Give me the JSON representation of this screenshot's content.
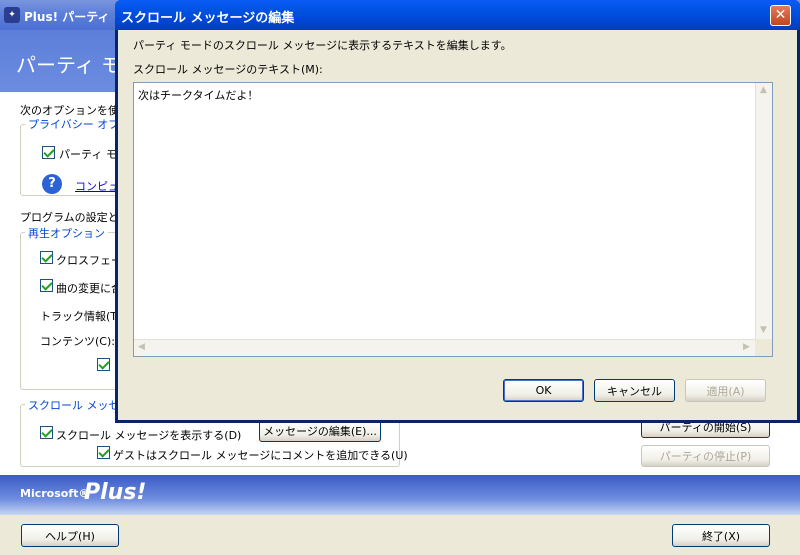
{
  "main_window": {
    "title": "Plus! パーティ モ",
    "banner_title": "パーティ モード",
    "intro_text": "次のオプションを使って",
    "privacy_group": {
      "title": "プライバシー オプショ",
      "checkbox_label": "パーティ モー",
      "link_text": "コンピュー"
    },
    "program_text": "プログラムの設定とゲ",
    "playback_group": {
      "title": "再生オプション",
      "crossfade_label": "クロスフェード",
      "song_change_label": "曲の変更に合",
      "track_info_label": "トラック情報(T):",
      "contents_label": "コンテンツ(C):"
    },
    "scroll_group": {
      "title": "スクロール メッセージ",
      "show_scroll_label": "スクロール メッセージを表示する(D)",
      "edit_message_button": "メッセージの編集(E)...",
      "guest_comment_label": "ゲストはスクロール メッセージにコメントを追加できる(U)"
    },
    "start_party_button": "パーティの開始(S)",
    "stop_party_button": "パーティの停止(P)",
    "brand_microsoft": "Microsoft®",
    "brand_plus": "Plus!",
    "help_button": "ヘルプ(H)",
    "exit_button": "終了(X)"
  },
  "dialog": {
    "title": "スクロール メッセージの編集",
    "description": "パーティ モードのスクロール メッセージに表示するテキストを編集します。",
    "textarea_label": "スクロール メッセージのテキスト(M):",
    "textarea_value": "次はチークタイムだよ！",
    "ok_button": "OK",
    "cancel_button": "キャンセル",
    "apply_button": "適用(A)",
    "close_glyph": "✕"
  },
  "icons": {
    "help": "question-icon",
    "close": "close-icon"
  }
}
